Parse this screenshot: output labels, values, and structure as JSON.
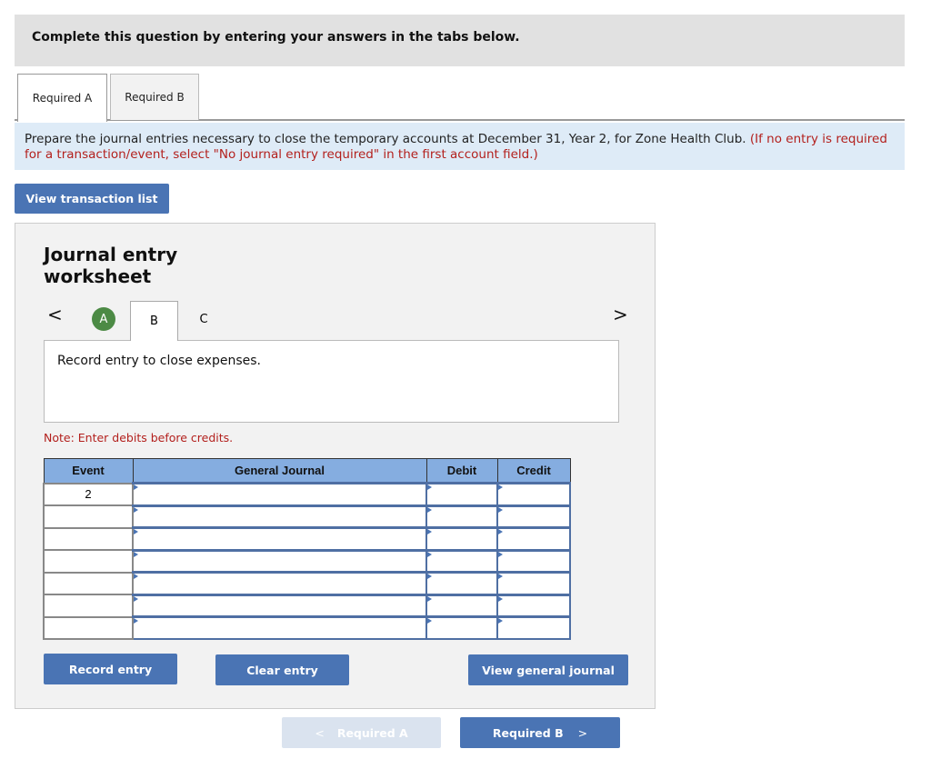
{
  "instruction": "Complete this question by entering your answers in the tabs below.",
  "tabs": [
    {
      "label": "Required A",
      "active": true
    },
    {
      "label": "Required B",
      "active": false
    }
  ],
  "prompt": {
    "main": "Prepare the journal entries necessary to close the temporary accounts at December 31, Year 2, for Zone Health Club.",
    "note": "(If no entry is required for a transaction/event, select \"No journal entry required\" in the first account field.)"
  },
  "view_transaction_list_label": "View transaction list",
  "worksheet": {
    "title_line1": "Journal entry",
    "title_line2": "worksheet",
    "nav_prev": "<",
    "nav_next": ">",
    "steps": [
      {
        "label": "A",
        "status": "completed"
      },
      {
        "label": "B",
        "status": "current"
      },
      {
        "label": "C",
        "status": "pending"
      }
    ],
    "description": "Record entry to close expenses.",
    "note": "Note: Enter debits before credits.",
    "table": {
      "headers": [
        "Event",
        "General Journal",
        "Debit",
        "Credit"
      ],
      "rows": [
        {
          "event": "2",
          "account": "",
          "debit": "",
          "credit": ""
        },
        {
          "event": "",
          "account": "",
          "debit": "",
          "credit": ""
        },
        {
          "event": "",
          "account": "",
          "debit": "",
          "credit": ""
        },
        {
          "event": "",
          "account": "",
          "debit": "",
          "credit": ""
        },
        {
          "event": "",
          "account": "",
          "debit": "",
          "credit": ""
        },
        {
          "event": "",
          "account": "",
          "debit": "",
          "credit": ""
        },
        {
          "event": "",
          "account": "",
          "debit": "",
          "credit": ""
        }
      ]
    },
    "buttons": {
      "record": "Record entry",
      "clear": "Clear entry",
      "view_journal": "View general journal"
    }
  },
  "footer_nav": {
    "prev_label": "Required A",
    "prev_icon": "<",
    "next_label": "Required B",
    "next_icon": ">"
  },
  "colors": {
    "primary_button": "#4a74b4",
    "disabled_button": "#dae3ef",
    "table_header": "#85ade0",
    "step_completed": "#4c8a45",
    "red_text": "#b3201d",
    "prompt_bg": "#deebf7"
  }
}
